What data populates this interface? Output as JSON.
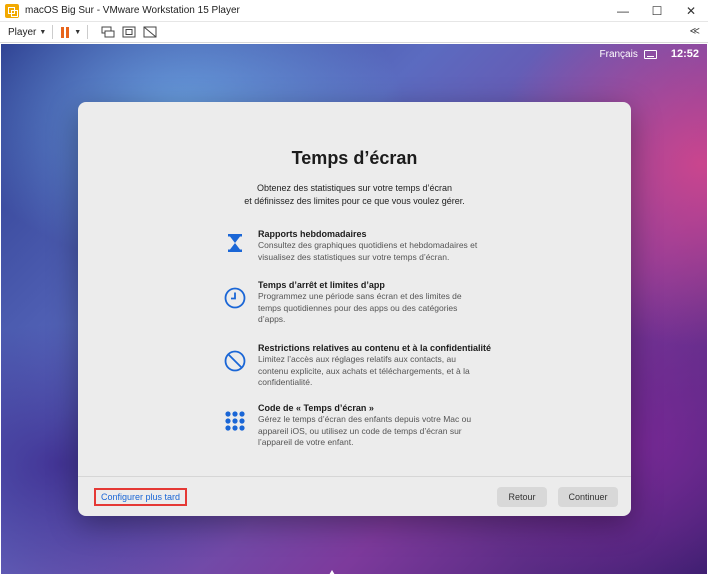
{
  "window": {
    "title": "macOS Big Sur - VMware Workstation 15 Player",
    "minimize": "—",
    "maximize": "☐",
    "close": "✕"
  },
  "toolbar": {
    "player_menu": "Player",
    "collapse": "≪"
  },
  "menubar": {
    "language": "Français",
    "time": "12:52"
  },
  "dialog": {
    "title": "Temps d’écran",
    "subtitle_line1": "Obtenez des statistiques sur votre temps d’écran",
    "subtitle_line2": "et définissez des limites pour ce que vous voulez gérer.",
    "features": [
      {
        "icon": "hourglass-icon",
        "title": "Rapports hebdomadaires",
        "desc": [
          "Consultez des graphiques quotidiens et hebdomadaires et",
          "visualisez des statistiques sur votre temps d’écran."
        ]
      },
      {
        "icon": "clock-icon",
        "title": "Temps d’arrêt et limites d’app",
        "desc": [
          "Programmez une période sans écran et des limites de",
          "temps quotidiennes pour des apps ou des catégories",
          "d’apps."
        ]
      },
      {
        "icon": "restriction-icon",
        "title": "Restrictions relatives au contenu et à la confidentialité",
        "desc": [
          "Limitez l’accès aux réglages relatifs aux contacts, au",
          "contenu explicite, aux achats et téléchargements, et à la",
          "confidentialité."
        ]
      },
      {
        "icon": "passcode-grid-icon",
        "title": "Code de « Temps d’écran »",
        "desc": [
          "Gérez le temps d’écran des enfants depuis votre Mac ou",
          "appareil iOS, ou utilisez un code de temps d’écran sur",
          "l’appareil de votre enfant."
        ]
      }
    ],
    "setup_later": "Configurer plus tard",
    "back": "Retour",
    "continue": "Continuer"
  },
  "colors": {
    "accent": "#1a66d6",
    "highlight_border": "#e53935",
    "pause": "#e8641b"
  }
}
